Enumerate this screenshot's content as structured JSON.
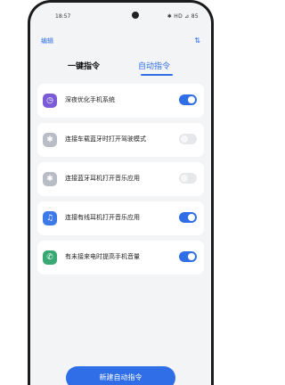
{
  "status_bar": {
    "time": "18:57",
    "indicators": "✱ HD ⊿ 85"
  },
  "header": {
    "edit_label": "编辑",
    "sort_icon": "sort-arrows-icon"
  },
  "tabs": [
    {
      "label": "一键指令",
      "active": false
    },
    {
      "label": "自动指令",
      "active": true
    }
  ],
  "commands": [
    {
      "label": "深夜优化手机系统",
      "icon": "moon-clock-icon",
      "icon_color": "#7b5cd6",
      "enabled": true
    },
    {
      "label": "连接车载蓝牙时打开驾驶模式",
      "icon": "bluetooth-car-icon",
      "icon_color": "#b9bdc6",
      "enabled": false
    },
    {
      "label": "连接蓝牙耳机打开音乐应用",
      "icon": "bluetooth-icon",
      "icon_color": "#b9bdc6",
      "enabled": false
    },
    {
      "label": "连接有线耳机打开音乐应用",
      "icon": "headphone-icon",
      "icon_color": "#3d7ae8",
      "enabled": true
    },
    {
      "label": "有未接来电时提高手机音量",
      "icon": "phone-icon",
      "icon_color": "#3aa873",
      "enabled": true
    }
  ],
  "new_button_label": "新建自动指令",
  "colors": {
    "accent": "#2f6ee6",
    "background": "#f3f4f6"
  }
}
